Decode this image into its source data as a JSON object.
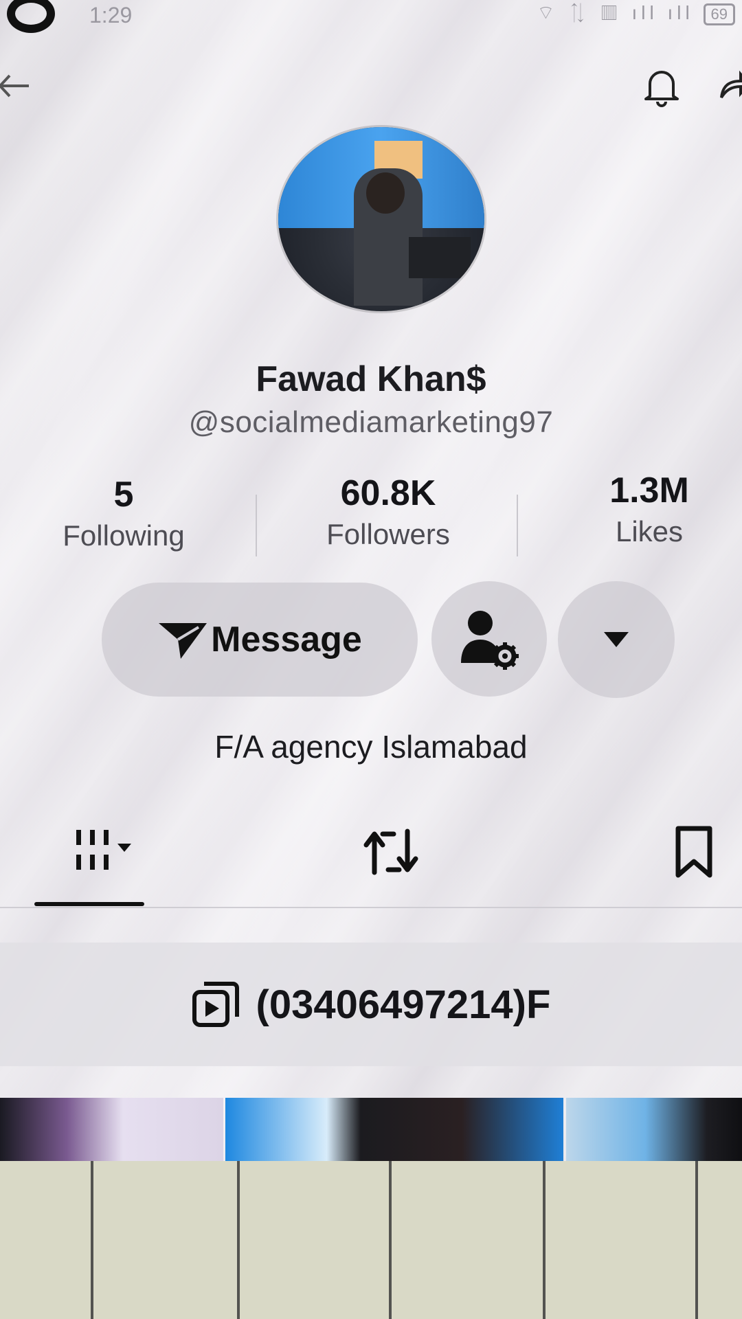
{
  "status_bar": {
    "time": "1:29",
    "indicators": "⌔ ⇅ ▥ ıll ıll",
    "battery": "69"
  },
  "profile": {
    "display_name": "Fawad Khan$",
    "username": "@socialmediamarketing97",
    "bio": "F/A agency Islamabad"
  },
  "stats": [
    {
      "value": "5",
      "label": "Following"
    },
    {
      "value": "60.8K",
      "label": "Followers"
    },
    {
      "value": "1.3M",
      "label": "Likes"
    }
  ],
  "actions": {
    "message_label": "Message"
  },
  "tabs": [
    "videos",
    "reposts",
    "saved"
  ],
  "pinned_playlist": {
    "label": "(03406497214)F"
  }
}
